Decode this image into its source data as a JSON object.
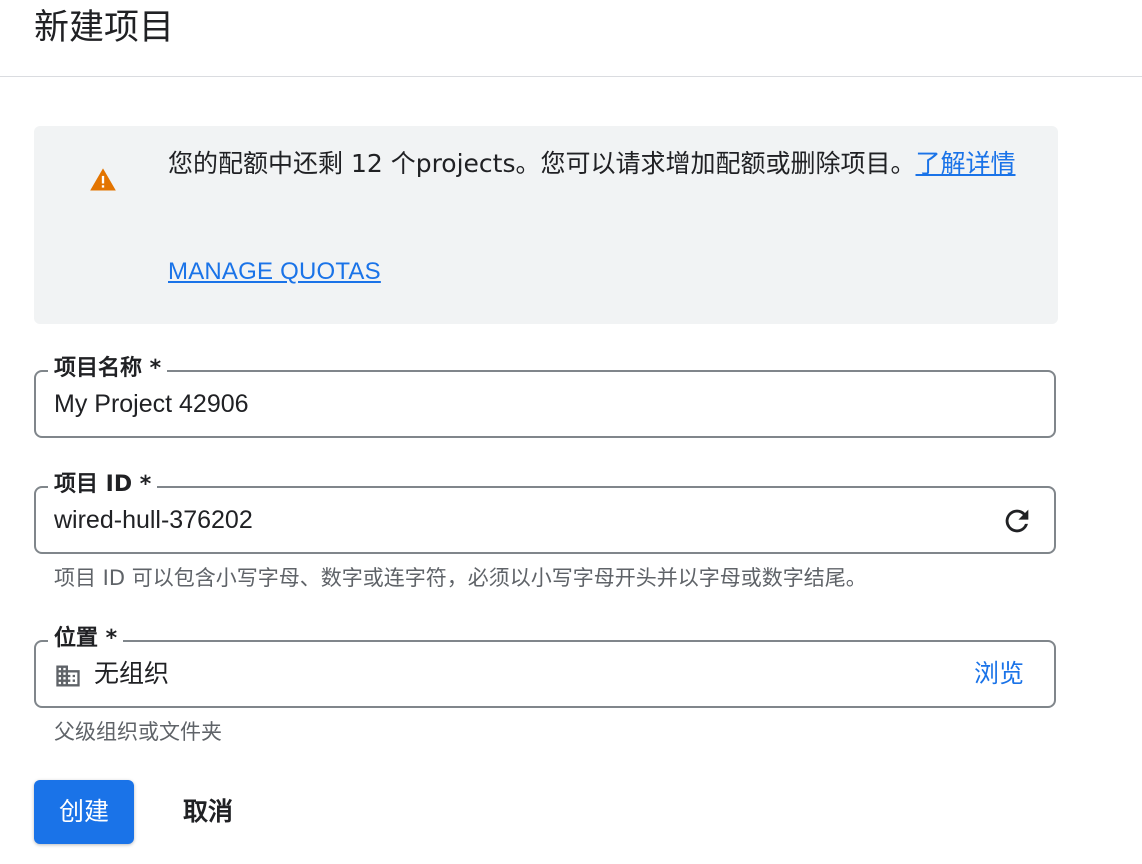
{
  "header": {
    "title": "新建项目"
  },
  "quota_alert": {
    "icon": "warning-icon",
    "icon_color": "#e37400",
    "message": "您的配额中还剩 12 个projects。您可以请求增加配额或删除项目。",
    "learn_more_label": "了解详情",
    "manage_quotas_label": "MANAGE QUOTAS"
  },
  "form": {
    "project_name": {
      "label": "项目名称 *",
      "value": "My Project 42906"
    },
    "project_id": {
      "label": "项目 ID *",
      "value": "wired-hull-376202",
      "refresh_icon": "refresh-icon",
      "hint": "项目 ID 可以包含小写字母、数字或连字符，必须以小写字母开头并以字母或数字结尾。"
    },
    "location": {
      "label": "位置 *",
      "icon": "building-icon",
      "value": "无组织",
      "browse_label": "浏览",
      "hint": "父级组织或文件夹"
    }
  },
  "actions": {
    "create_label": "创建",
    "cancel_label": "取消"
  },
  "colors": {
    "accent": "#1a73e8",
    "warning": "#e37400",
    "alert_background": "#f1f3f4"
  }
}
